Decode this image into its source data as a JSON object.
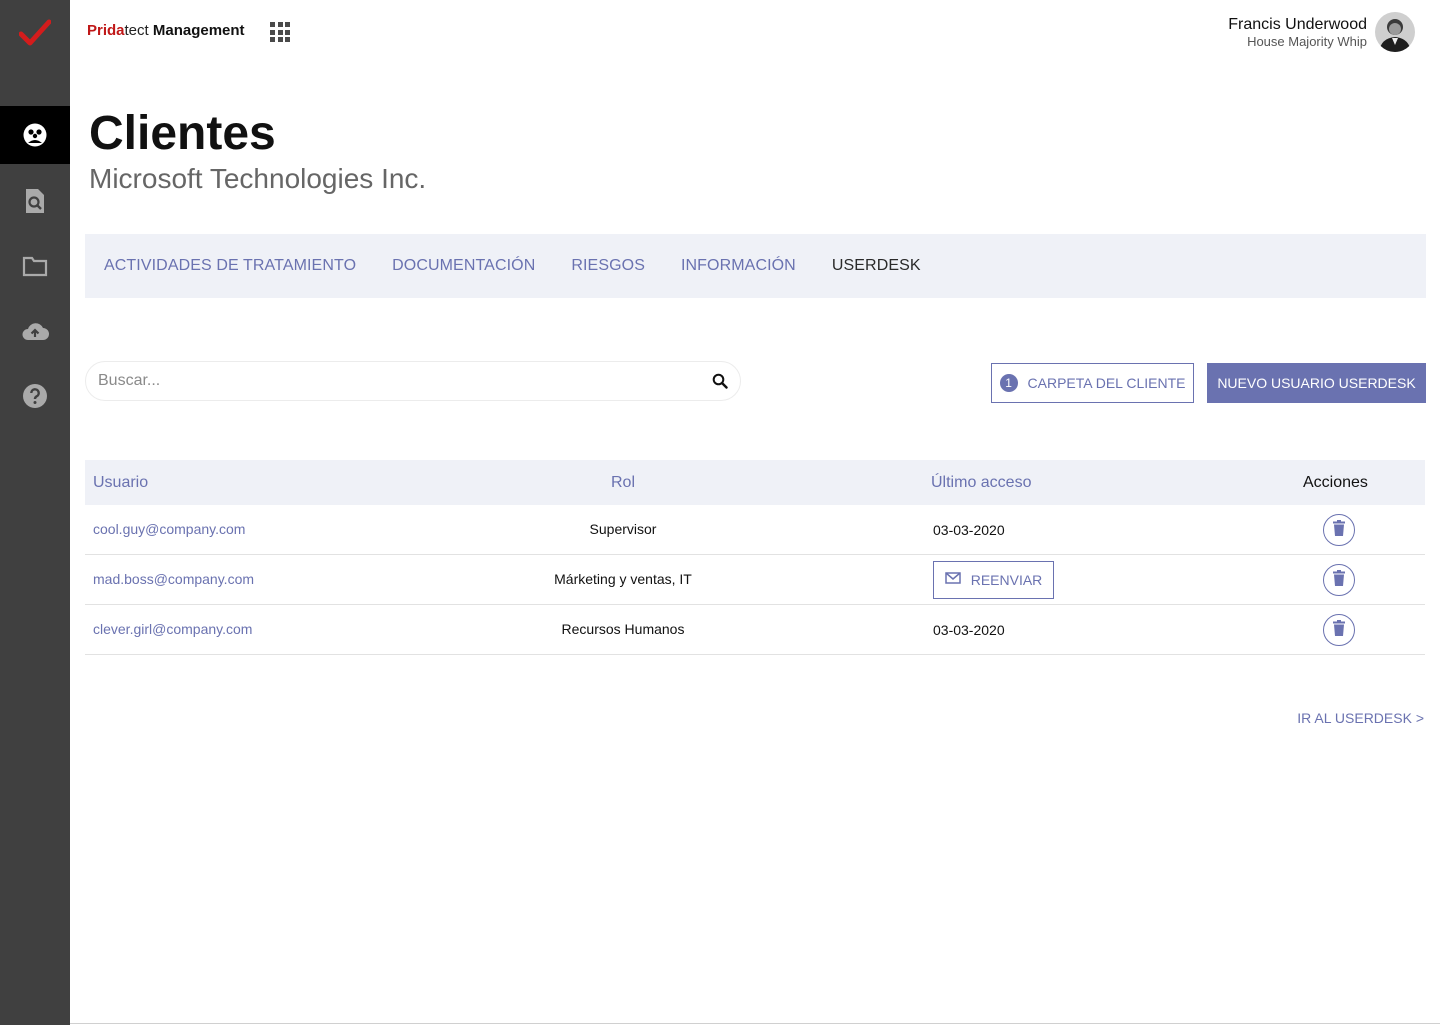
{
  "brand": {
    "part1": "Prida",
    "part2": "tect",
    "part3": " Management"
  },
  "sidebar": {
    "logo_icon": "checkmark-logo-icon",
    "items": [
      {
        "icon": "clients-icon",
        "active": true
      },
      {
        "icon": "document-search-icon",
        "active": false
      },
      {
        "icon": "folder-icon",
        "active": false
      },
      {
        "icon": "cloud-upload-icon",
        "active": false
      },
      {
        "icon": "help-icon",
        "active": false
      }
    ]
  },
  "user": {
    "name": "Francis Underwood",
    "role": "House Majority Whip"
  },
  "page": {
    "title": "Clientes",
    "subtitle": "Microsoft Technologies Inc."
  },
  "tabs": [
    {
      "label": "ACTIVIDADES DE TRATAMIENTO",
      "active": false
    },
    {
      "label": "DOCUMENTACIÓN",
      "active": false
    },
    {
      "label": "RIESGOS",
      "active": false
    },
    {
      "label": "INFORMACIÓN",
      "active": false
    },
    {
      "label": "USERDESK",
      "active": true
    }
  ],
  "search": {
    "placeholder": "Buscar...",
    "value": ""
  },
  "actions": {
    "folder_badge": "1",
    "folder_label": "CARPETA DEL CLIENTE",
    "new_user_label": "NUEVO USUARIO USERDESK"
  },
  "table": {
    "headers": {
      "user": "Usuario",
      "role": "Rol",
      "last_access": "Último acceso",
      "actions": "Acciones"
    },
    "rows": [
      {
        "user": "cool.guy@company.com",
        "role": "Supervisor",
        "last_access": "03-03-2020"
      },
      {
        "user": "mad.boss@company.com",
        "role": "Márketing y ventas, IT",
        "last_access": "",
        "resend_label": "REENVIAR"
      },
      {
        "user": "clever.girl@company.com",
        "role": "Recursos Humanos",
        "last_access": "03-03-2020"
      }
    ]
  },
  "go_userdesk": "IR AL USERDESK >",
  "colors": {
    "accent": "#6a72b0",
    "sidebar": "#404040",
    "brand_red": "#c01818",
    "tab_bg": "#eff1f7"
  }
}
